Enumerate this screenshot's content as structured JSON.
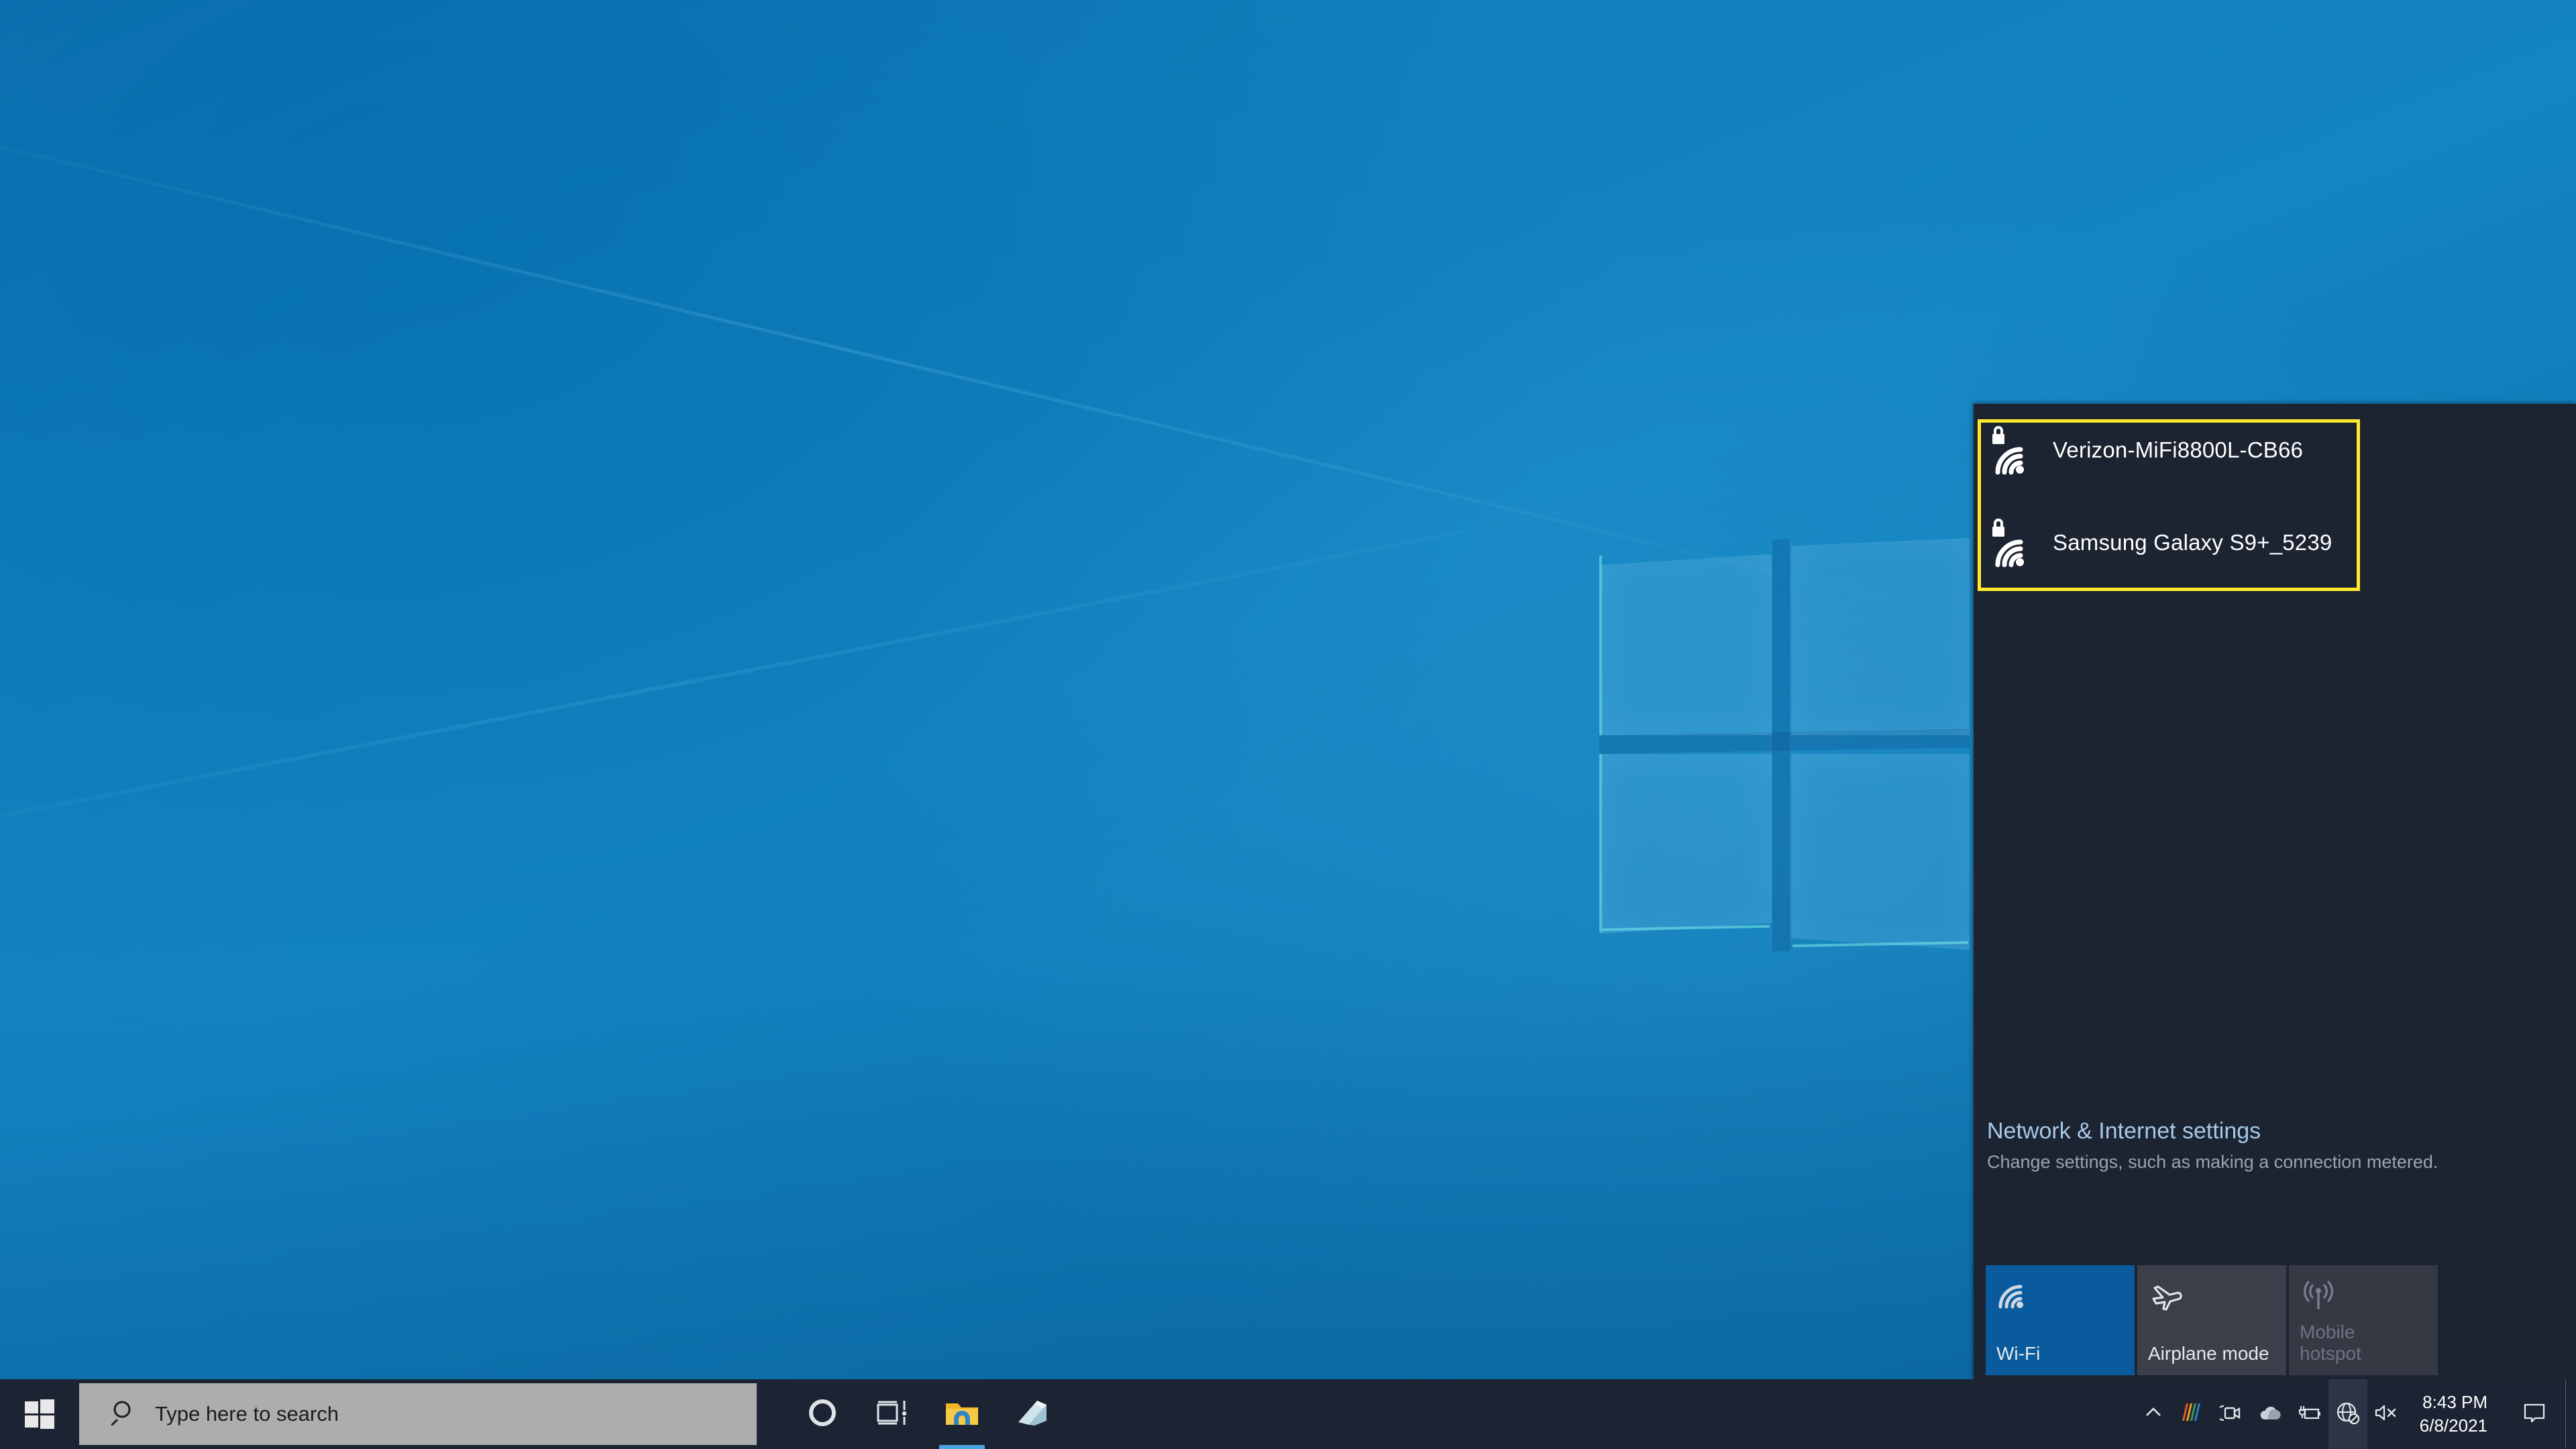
{
  "desktop": {
    "wallpaper_name": "windows-10-hero-wallpaper",
    "background_color": "#0f7bb8"
  },
  "network_flyout": {
    "highlight_box_color": "#ffeb2e",
    "background_color": "#1c2331",
    "networks": [
      {
        "ssid": "Verizon-MiFi8800L-CB66",
        "secured": true,
        "icon": "wifi-lock-icon",
        "signal_bars": 3
      },
      {
        "ssid": "Samsung Galaxy S9+_5239",
        "secured": true,
        "icon": "wifi-lock-icon",
        "signal_bars": 3
      }
    ],
    "settings_link": {
      "title": "Network & Internet settings",
      "title_color": "#a8c9e6",
      "subtitle": "Change settings, such as making a connection metered."
    },
    "quick_actions": [
      {
        "label": "Wi-Fi",
        "icon": "wifi-icon",
        "state": "active",
        "color": "#0a5b9e"
      },
      {
        "label": "Airplane mode",
        "icon": "airplane-icon",
        "state": "off",
        "color": "#3a3f4a"
      },
      {
        "label": "Mobile\nhotspot",
        "icon": "hotspot-icon",
        "state": "disabled",
        "color": "#343944"
      }
    ]
  },
  "taskbar": {
    "background_color": "#1c2433",
    "start_button": {
      "icon": "windows-logo-icon",
      "label": "Start"
    },
    "search": {
      "placeholder": "Type here to search",
      "icon": "search-icon",
      "value": ""
    },
    "apps": [
      {
        "name": "Cortana",
        "icon": "cortana-circle-icon",
        "running": false
      },
      {
        "name": "Task View",
        "icon": "task-view-icon",
        "running": false
      },
      {
        "name": "File Explorer",
        "icon": "file-explorer-icon",
        "running": true
      },
      {
        "name": "Sticky Notes",
        "icon": "sticky-notes-icon",
        "running": false
      }
    ],
    "tray": [
      {
        "name": "show-hidden-icons",
        "icon": "chevron-up-icon"
      },
      {
        "name": "app-tray-icon",
        "icon": "colored-bars-icon"
      },
      {
        "name": "camera-tray-icon",
        "icon": "webcam-icon"
      },
      {
        "name": "onedrive",
        "icon": "cloud-icon"
      },
      {
        "name": "battery",
        "icon": "battery-plug-icon"
      },
      {
        "name": "network",
        "icon": "globe-no-internet-icon",
        "highlighted": true
      },
      {
        "name": "volume",
        "icon": "speaker-muted-icon"
      }
    ],
    "clock": {
      "time": "8:43 PM",
      "date": "6/8/2021"
    },
    "action_center": {
      "icon": "action-center-icon"
    }
  }
}
